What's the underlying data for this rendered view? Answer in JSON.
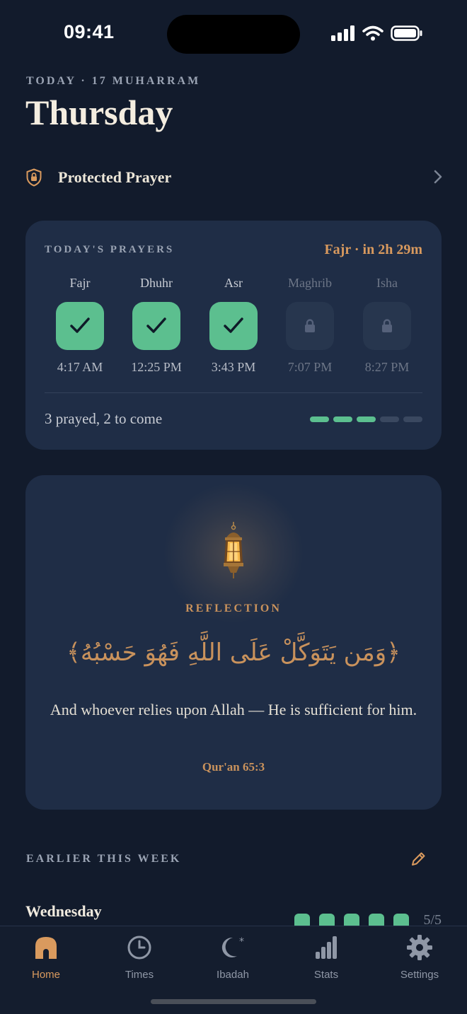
{
  "status": {
    "time": "09:41"
  },
  "header": {
    "date_line": "TODAY · 17 MUHARRAM",
    "day": "Thursday"
  },
  "protected": {
    "label": "Protected Prayer",
    "icon": "shield-lock-icon"
  },
  "prayers": {
    "label": "TODAY'S PRAYERS",
    "next": "Fajr · in 2h 29m",
    "items": [
      {
        "name": "Fajr",
        "time": "4:17 AM",
        "status": "done"
      },
      {
        "name": "Dhuhr",
        "time": "12:25 PM",
        "status": "done"
      },
      {
        "name": "Asr",
        "time": "3:43 PM",
        "status": "done"
      },
      {
        "name": "Maghrib",
        "time": "7:07 PM",
        "status": "locked"
      },
      {
        "name": "Isha",
        "time": "8:27 PM",
        "status": "locked"
      }
    ],
    "summary": "3 prayed, 2 to come",
    "progress": {
      "done": 3,
      "total": 5
    }
  },
  "reflection": {
    "label": "REFLECTION",
    "arabic": "﴿وَمَن يَتَوَكَّلْ عَلَى اللَّهِ فَهُوَ حَسْبُهُ﴾",
    "translation": "And whoever relies upon Allah — He is sufficient for him.",
    "citation": "Qur'an 65:3"
  },
  "week": {
    "label": "EARLIER THIS WEEK",
    "rows": [
      {
        "day": "Wednesday",
        "prayed": 5,
        "total": 5,
        "count": "5/5"
      }
    ]
  },
  "tabs": [
    {
      "label": "Home",
      "icon": "home-icon",
      "active": true
    },
    {
      "label": "Times",
      "icon": "clock-icon",
      "active": false
    },
    {
      "label": "Ibadah",
      "icon": "crescent-star-icon",
      "active": false
    },
    {
      "label": "Stats",
      "icon": "bar-chart-icon",
      "active": false
    },
    {
      "label": "Settings",
      "icon": "gear-icon",
      "active": false
    }
  ],
  "colors": {
    "accent": "#d99a5e",
    "success": "#5cbf8f",
    "background": "#121b2c",
    "card": "#1f2d46"
  }
}
